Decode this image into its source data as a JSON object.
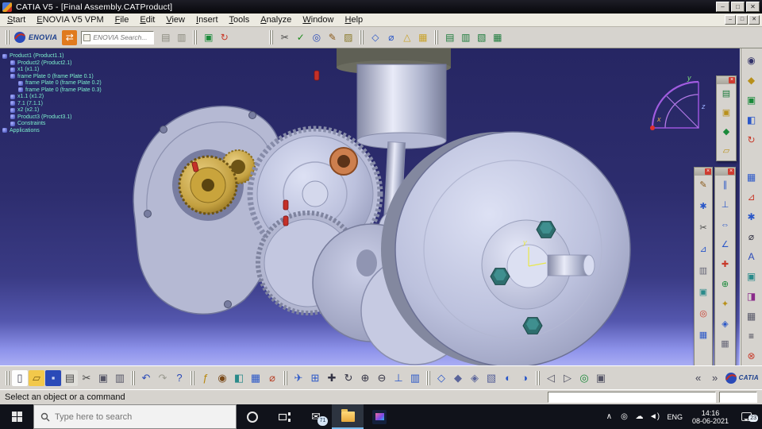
{
  "window": {
    "title": "CATIA V5 - [Final Assembly.CATProduct]",
    "controls": {
      "minimize": "–",
      "maximize": "□",
      "close": "✕"
    }
  },
  "menubar": {
    "items": [
      "Start",
      "ENOVIA V5 VPM",
      "File",
      "Edit",
      "View",
      "Insert",
      "Tools",
      "Analyze",
      "Window",
      "Help"
    ]
  },
  "top_toolbar": {
    "brand": "ENOVIA",
    "search_placeholder": "ENOVIA Search...",
    "icons_a": [
      {
        "n": "enovia-transfer",
        "g": "⇄",
        "c": "#fff",
        "b": "#e07a1e"
      }
    ],
    "icons_b": [
      {
        "n": "paste-from-enovia",
        "g": "▤",
        "c": "#8a8a7e"
      },
      {
        "n": "enovia-clipboard",
        "g": "▥",
        "c": "#8a8a7e"
      }
    ],
    "icons_c": [
      {
        "n": "new-window",
        "g": "▣",
        "c": "#1a8a3a"
      },
      {
        "n": "refresh",
        "g": "↻",
        "c": "#c83a2a"
      }
    ],
    "icons_d": [
      {
        "n": "scissors",
        "g": "✂",
        "c": "#444"
      },
      {
        "n": "spell-check",
        "g": "✓",
        "c": "#1a8a1a"
      },
      {
        "n": "search-lens",
        "g": "◎",
        "c": "#2a4ab8"
      },
      {
        "n": "pencil",
        "g": "✎",
        "c": "#8a5a1a"
      },
      {
        "n": "stamp",
        "g": "▨",
        "c": "#8a7a2a"
      }
    ],
    "icons_e": [
      {
        "n": "view-cube",
        "g": "◇",
        "c": "#2a57c8"
      },
      {
        "n": "measure-between",
        "g": "⌀",
        "c": "#2a57c8"
      },
      {
        "n": "measure-item",
        "g": "△",
        "c": "#c8a22a"
      },
      {
        "n": "measure-inertia",
        "g": "▦",
        "c": "#c8a22a"
      }
    ],
    "icons_f": [
      {
        "n": "catalog",
        "g": "▤",
        "c": "#1a7a3a"
      },
      {
        "n": "library",
        "g": "▥",
        "c": "#1a7a3a"
      },
      {
        "n": "components",
        "g": "▧",
        "c": "#1a7a3a"
      },
      {
        "n": "publications",
        "g": "▦",
        "c": "#1a7a3a"
      }
    ]
  },
  "tree": {
    "items": [
      {
        "t": "Product1 (Product1.1)",
        "d": 0
      },
      {
        "t": "Product2 (Product2.1)",
        "d": 1
      },
      {
        "t": "x1 (x1.1)",
        "d": 1
      },
      {
        "t": "frame Plate 0 (frame Plate 0.1)",
        "d": 1
      },
      {
        "t": "frame Plate 0 (frame Plate 0.2)",
        "d": 2
      },
      {
        "t": "frame Plate 0 (frame Plate 0.3)",
        "d": 2
      },
      {
        "t": "x1.1 (x1.2)",
        "d": 1
      },
      {
        "t": "7.1 (7.1.1)",
        "d": 1
      },
      {
        "t": "x2 (x2.1)",
        "d": 1
      },
      {
        "t": "Product3 (Product3.1)",
        "d": 1
      },
      {
        "t": "Constraints",
        "d": 1
      },
      {
        "t": "Applications",
        "d": 0
      }
    ]
  },
  "viewport": {
    "compass": {
      "x": "x",
      "y": "y",
      "z": "z"
    }
  },
  "panels": {
    "panel_a": {
      "icons": [
        {
          "n": "catalog-browser",
          "g": "▤",
          "c": "#1a7a3a"
        },
        {
          "n": "parts-browser",
          "g": "▣",
          "c": "#b8901a"
        },
        {
          "n": "save-management",
          "g": "◆",
          "c": "#1a8a3a"
        },
        {
          "n": "open-catalog",
          "g": "▱",
          "c": "#b8901a"
        }
      ]
    },
    "panel_b": {
      "icons": [
        {
          "n": "sketch",
          "g": "✎",
          "c": "#8a5a1a"
        },
        {
          "n": "gear-design",
          "g": "✱",
          "c": "#2a57c8"
        },
        {
          "n": "trim",
          "g": "✂",
          "c": "#444"
        },
        {
          "n": "axis-system",
          "g": "⊿",
          "c": "#2a57c8"
        },
        {
          "n": "clipboard",
          "g": "▥",
          "c": "#667"
        },
        {
          "n": "image-capture",
          "g": "▣",
          "c": "#2a8a8a"
        },
        {
          "n": "zoom-area",
          "g": "◎",
          "c": "#c83a2a"
        },
        {
          "n": "design-table",
          "g": "▦",
          "c": "#2a57c8"
        }
      ]
    },
    "panel_c": {
      "icons": [
        {
          "n": "coincidence-constraint",
          "g": "∥",
          "c": "#2a57c8"
        },
        {
          "n": "contact-constraint",
          "g": "⊥",
          "c": "#2a57c8"
        },
        {
          "n": "offset-constraint",
          "g": "⇔",
          "c": "#2a57c8"
        },
        {
          "n": "angle-constraint",
          "g": "∠",
          "c": "#2a57c8"
        },
        {
          "n": "fix-constraint",
          "g": "✚",
          "c": "#c83a2a"
        },
        {
          "n": "fix-together",
          "g": "⊕",
          "c": "#1a8a3a"
        },
        {
          "n": "quick-constraint",
          "g": "✦",
          "c": "#b8901a"
        },
        {
          "n": "flexible-rigid",
          "g": "◈",
          "c": "#2a57c8"
        },
        {
          "n": "change-constraint",
          "g": "▦",
          "c": "#667"
        }
      ]
    },
    "dock": {
      "icons": [
        {
          "n": "eye",
          "g": "◉",
          "c": "#33336a"
        },
        {
          "n": "paint-all",
          "g": "◆",
          "c": "#b8901a"
        },
        {
          "n": "catalog-dock",
          "g": "▣",
          "c": "#1a8a3a"
        },
        {
          "n": "material-dock",
          "g": "◧",
          "c": "#2a57c8"
        },
        {
          "n": "update",
          "g": "↻",
          "c": "#c83a2a"
        },
        {
          "n": "layers-dock",
          "g": "▦",
          "c": "#2a57c8",
          "gap": true
        },
        {
          "n": "axis-dock",
          "g": "⊿",
          "c": "#c83a2a"
        },
        {
          "n": "tools-palette",
          "g": "✱",
          "c": "#2a57c8"
        },
        {
          "n": "measure-dock",
          "g": "⌀",
          "c": "#334"
        },
        {
          "n": "annotation",
          "g": "A",
          "c": "#2a4ab8"
        },
        {
          "n": "picture-dock",
          "g": "▣",
          "c": "#2a8a8a"
        },
        {
          "n": "section",
          "g": "◨",
          "c": "#8a2a8a"
        },
        {
          "n": "grid-dock",
          "g": "▦",
          "c": "#556"
        },
        {
          "n": "scan",
          "g": "≡",
          "c": "#334"
        },
        {
          "n": "exit-workbench",
          "g": "⊗",
          "c": "#c83a2a"
        }
      ]
    }
  },
  "bottom_toolbar": {
    "brand": "CATIA",
    "icons": [
      {
        "n": "new-document",
        "g": "▯",
        "c": "#445",
        "b": "#fdfdfd"
      },
      {
        "n": "open-folder",
        "g": "▱",
        "c": "#7a5c10",
        "b": "#f2c84b"
      },
      {
        "n": "save",
        "g": "▪",
        "c": "#cdd6f2",
        "b": "#2a4ab8"
      },
      {
        "n": "print",
        "g": "▤",
        "c": "#454545",
        "b": "#e0dfda"
      },
      {
        "n": "cut",
        "g": "✂",
        "c": "#444"
      },
      {
        "n": "copy",
        "g": "▣",
        "c": "#556"
      },
      {
        "n": "paste",
        "g": "▥",
        "c": "#556"
      },
      {
        "sep": true
      },
      {
        "n": "undo",
        "g": "↶",
        "c": "#2a4ab8"
      },
      {
        "n": "redo",
        "g": "↷",
        "c": "#9a9a90"
      },
      {
        "n": "what-is-this",
        "g": "?",
        "c": "#2a4ab8"
      },
      {
        "sep": true
      },
      {
        "n": "formula",
        "g": "ƒ",
        "c": "#b8860b"
      },
      {
        "n": "knowledge-browser",
        "g": "◉",
        "c": "#7a4a1a"
      },
      {
        "n": "apply-material",
        "g": "◧",
        "c": "#2a8a8a"
      },
      {
        "n": "product-graph",
        "g": "▦",
        "c": "#2a57c8"
      },
      {
        "n": "datum",
        "g": "⌀",
        "c": "#b8432a"
      },
      {
        "sep": true
      },
      {
        "n": "fly-mode",
        "g": "✈",
        "c": "#2a57c8"
      },
      {
        "n": "fit-all-in",
        "g": "⊞",
        "c": "#2a57c8"
      },
      {
        "n": "pan",
        "g": "✚",
        "c": "#334"
      },
      {
        "n": "rotate",
        "g": "↻",
        "c": "#334"
      },
      {
        "n": "zoom-in",
        "g": "⊕",
        "c": "#334"
      },
      {
        "n": "zoom-out",
        "g": "⊖",
        "c": "#334"
      },
      {
        "n": "normal-view",
        "g": "⊥",
        "c": "#2a57c8"
      },
      {
        "n": "multi-view",
        "g": "▥",
        "c": "#2a57c8"
      },
      {
        "sep": true
      },
      {
        "n": "iso-view",
        "g": "◇",
        "c": "#2a57c8"
      },
      {
        "n": "shaded-view",
        "g": "◆",
        "c": "#5a649a"
      },
      {
        "n": "wireframe-view",
        "g": "◈",
        "c": "#5a649a"
      },
      {
        "n": "render-style",
        "g": "▧",
        "c": "#5a649a"
      },
      {
        "n": "hide-show",
        "g": "◐",
        "c": "#2a57c8"
      },
      {
        "n": "swap-visible-space",
        "g": "◑",
        "c": "#2a57c8"
      },
      {
        "sep": true
      },
      {
        "n": "previous-view",
        "g": "◁",
        "c": "#556"
      },
      {
        "n": "next-view",
        "g": "▷",
        "c": "#556"
      },
      {
        "n": "magnifier",
        "g": "◎",
        "c": "#1a8a3a"
      },
      {
        "n": "capture",
        "g": "▣",
        "c": "#556"
      }
    ],
    "nav": [
      {
        "n": "toolbar-scroll-left",
        "g": "«",
        "c": "#445"
      },
      {
        "n": "toolbar-scroll-right",
        "g": "»",
        "c": "#445"
      }
    ]
  },
  "statusbar": {
    "message": "Select an object or a command"
  },
  "taskbar": {
    "search_placeholder": "Type here to search",
    "mail_glyph": "✉",
    "mail_badge": "71",
    "tray_icons": [
      {
        "n": "hidden-icons-chevron",
        "g": "∧",
        "c": "#fff"
      },
      {
        "n": "people",
        "g": "◎",
        "c": "#fff"
      },
      {
        "n": "onedrive",
        "g": "☁",
        "c": "#fff"
      },
      {
        "n": "volume",
        "g": "◄)",
        "c": "#fff"
      }
    ],
    "language": "ENG",
    "time": "14:16",
    "date": "08-06-2021",
    "notification_count": "23"
  }
}
